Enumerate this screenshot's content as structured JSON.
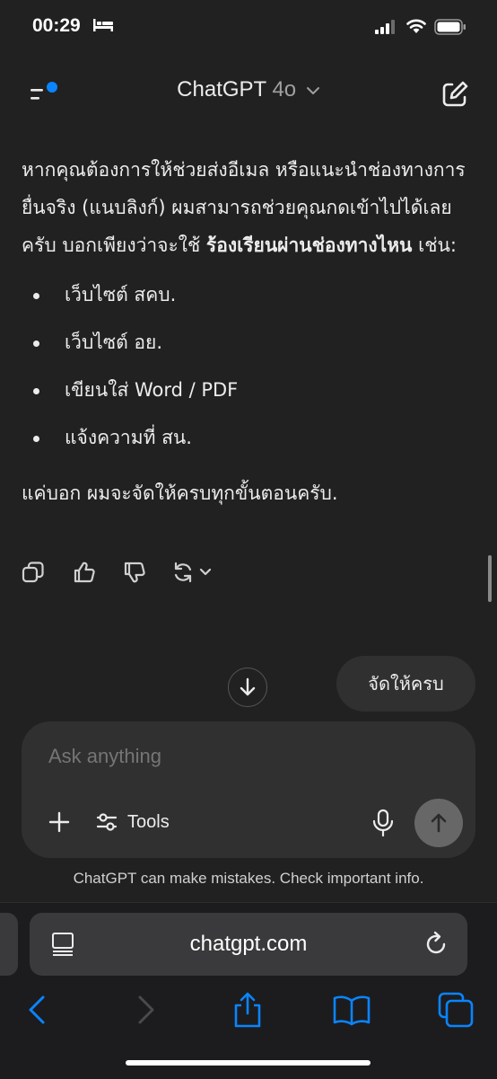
{
  "status_bar": {
    "time": "00:29"
  },
  "header": {
    "title": "ChatGPT",
    "model": "4o"
  },
  "message": {
    "intro": "หากคุณต้องการให้ช่วยส่งอีเมล หรือแนะนำช่องทางการยื่นจริง (แนบลิงก์) ผมสามารถช่วยคุณกดเข้าไปได้เลยครับ บอกเพียงว่าจะใช้ ",
    "intro_bold": "ร้องเรียนผ่านช่องทางไหน",
    "intro_end": " เช่น:",
    "bullets": [
      "เว็บไซต์ สคบ.",
      "เว็บไซต์ อย.",
      "เขียนใส่ Word / PDF",
      "แจ้งความที่ สน."
    ],
    "closing": "แค่บอก ผมจะจัดให้ครบทุกขั้นตอนครับ."
  },
  "suggestion": "จัดให้ครบ",
  "composer": {
    "placeholder": "Ask anything",
    "tools_label": "Tools"
  },
  "disclaimer": "ChatGPT can make mistakes. Check important info.",
  "browser": {
    "url": "chatgpt.com"
  },
  "colors": {
    "background": "#212121",
    "accent_blue": "#0a84ff",
    "composer": "#303030"
  }
}
